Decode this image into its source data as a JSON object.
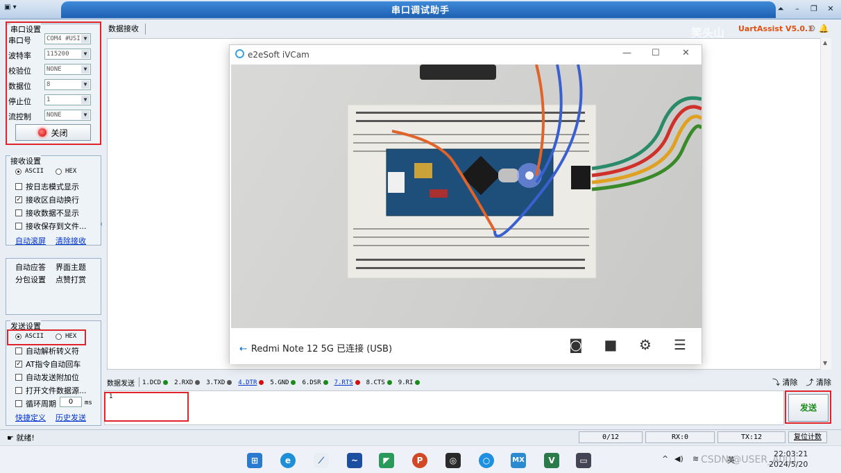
{
  "window": {
    "title": "串口调试助手",
    "sysmenu": "▾",
    "controls": [
      "⏶",
      "–",
      "❐",
      "✕"
    ]
  },
  "serial_settings": {
    "title": "串口设置",
    "rows": [
      {
        "label": "串口号",
        "value": "COM4 #USI"
      },
      {
        "label": "波特率",
        "value": "115200"
      },
      {
        "label": "校验位",
        "value": "NONE"
      },
      {
        "label": "数据位",
        "value": "8"
      },
      {
        "label": "停止位",
        "value": "1"
      },
      {
        "label": "流控制",
        "value": "NONE"
      }
    ],
    "close_button": "关闭"
  },
  "receive_settings": {
    "title": "接收设置",
    "ascii": "ASCII",
    "hex": "HEX",
    "options": [
      {
        "label": "按日志模式显示",
        "checked": false
      },
      {
        "label": "接收区自动换行",
        "checked": true
      },
      {
        "label": "接收数据不显示",
        "checked": false
      },
      {
        "label": "接收保存到文件...",
        "checked": false
      }
    ],
    "links": [
      "自动滚屏",
      "清除接收"
    ]
  },
  "misc": {
    "items": [
      "自动应答",
      "界面主题",
      "分包设置",
      "点赞打赏"
    ]
  },
  "send_settings": {
    "title": "发送设置",
    "ascii": "ASCII",
    "hex": "HEX",
    "options": [
      {
        "label": "自动解析转义符",
        "checked": false
      },
      {
        "label": "AT指令自动回车",
        "checked": true
      },
      {
        "label": "自动发送附加位",
        "checked": false
      },
      {
        "label": "打开文件数据源...",
        "checked": false
      },
      {
        "label": "循环周期",
        "checked": false
      }
    ],
    "period_value": "0",
    "period_unit": "ms",
    "links": [
      "快捷定义",
      "历史发送"
    ]
  },
  "receive_area": {
    "label": "数据接收",
    "watermark": "笑头山",
    "brand": "UartAssist V5.0.1"
  },
  "ivcam": {
    "title": "e2eSoft iVCam",
    "status": "Redmi Note 12 5G 已连接 (USB)"
  },
  "send_area": {
    "label": "数据发送",
    "pins": [
      {
        "label": "1.DCD",
        "color": "#1a8a1a",
        "link": false
      },
      {
        "label": "2.RXD",
        "color": "#555555",
        "link": false
      },
      {
        "label": "3.TXD",
        "color": "#555555",
        "link": false
      },
      {
        "label": "4.DTR",
        "color": "#d01010",
        "link": true
      },
      {
        "label": "5.GND",
        "color": "#1a8a1a",
        "link": false
      },
      {
        "label": "6.DSR",
        "color": "#1a8a1a",
        "link": false
      },
      {
        "label": "7.RTS",
        "color": "#d01010",
        "link": true
      },
      {
        "label": "8.CTS",
        "color": "#1a8a1a",
        "link": false
      },
      {
        "label": "9.RI",
        "color": "#1a8a1a",
        "link": false
      }
    ],
    "clear1": "清除",
    "clear2": "清除",
    "text": "1",
    "send_button": "发送"
  },
  "status_bar": {
    "ready": "就绪!",
    "count": "0/12",
    "rx": "RX:0",
    "tx": "TX:12",
    "reset": "复位计数"
  },
  "taskbar": {
    "ime": "英",
    "time": "22:03:21",
    "date": "2024/5/20",
    "watermark": "CSDN @USER_A001"
  },
  "colors": {
    "accent": "#1d5fb2",
    "highlight_red": "#e0232b",
    "send_green": "#1a8a1a"
  }
}
